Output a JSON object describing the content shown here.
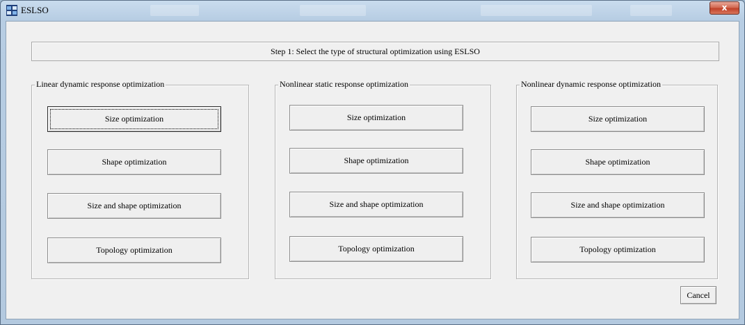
{
  "window": {
    "title": "ESLSO",
    "close_label": "x"
  },
  "step_text": "Step 1: Select the type of structural optimization using ESLSO",
  "groups": [
    {
      "title": "Linear dynamic response optimization",
      "buttons": [
        "Size optimization",
        "Shape optimization",
        "Size and shape optimization",
        "Topology optimization"
      ]
    },
    {
      "title": "Nonlinear static response optimization",
      "buttons": [
        "Size optimization",
        "Shape optimization",
        "Size and shape optimization",
        "Topology optimization"
      ]
    },
    {
      "title": "Nonlinear dynamic response optimization",
      "buttons": [
        "Size optimization",
        "Shape optimization",
        "Size and shape optimization",
        "Topology optimization"
      ]
    }
  ],
  "cancel_label": "Cancel",
  "colors": {
    "dialog_bg": "#f0f0f0",
    "frame": "#b7cde3",
    "close_button": "#c0422a"
  }
}
